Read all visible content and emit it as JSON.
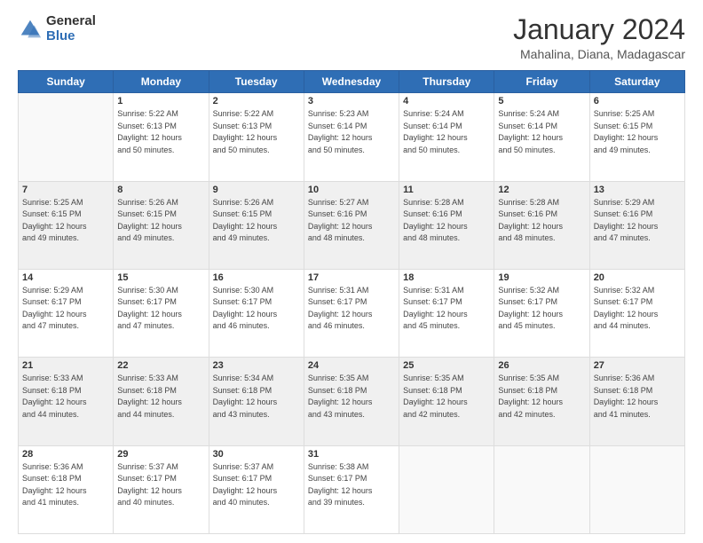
{
  "logo": {
    "general": "General",
    "blue": "Blue"
  },
  "title": "January 2024",
  "subtitle": "Mahalina, Diana, Madagascar",
  "days_of_week": [
    "Sunday",
    "Monday",
    "Tuesday",
    "Wednesday",
    "Thursday",
    "Friday",
    "Saturday"
  ],
  "weeks": [
    [
      {
        "day": "",
        "info": ""
      },
      {
        "day": "1",
        "info": "Sunrise: 5:22 AM\nSunset: 6:13 PM\nDaylight: 12 hours\nand 50 minutes."
      },
      {
        "day": "2",
        "info": "Sunrise: 5:22 AM\nSunset: 6:13 PM\nDaylight: 12 hours\nand 50 minutes."
      },
      {
        "day": "3",
        "info": "Sunrise: 5:23 AM\nSunset: 6:14 PM\nDaylight: 12 hours\nand 50 minutes."
      },
      {
        "day": "4",
        "info": "Sunrise: 5:24 AM\nSunset: 6:14 PM\nDaylight: 12 hours\nand 50 minutes."
      },
      {
        "day": "5",
        "info": "Sunrise: 5:24 AM\nSunset: 6:14 PM\nDaylight: 12 hours\nand 50 minutes."
      },
      {
        "day": "6",
        "info": "Sunrise: 5:25 AM\nSunset: 6:15 PM\nDaylight: 12 hours\nand 49 minutes."
      }
    ],
    [
      {
        "day": "7",
        "info": "Sunrise: 5:25 AM\nSunset: 6:15 PM\nDaylight: 12 hours\nand 49 minutes."
      },
      {
        "day": "8",
        "info": "Sunrise: 5:26 AM\nSunset: 6:15 PM\nDaylight: 12 hours\nand 49 minutes."
      },
      {
        "day": "9",
        "info": "Sunrise: 5:26 AM\nSunset: 6:15 PM\nDaylight: 12 hours\nand 49 minutes."
      },
      {
        "day": "10",
        "info": "Sunrise: 5:27 AM\nSunset: 6:16 PM\nDaylight: 12 hours\nand 48 minutes."
      },
      {
        "day": "11",
        "info": "Sunrise: 5:28 AM\nSunset: 6:16 PM\nDaylight: 12 hours\nand 48 minutes."
      },
      {
        "day": "12",
        "info": "Sunrise: 5:28 AM\nSunset: 6:16 PM\nDaylight: 12 hours\nand 48 minutes."
      },
      {
        "day": "13",
        "info": "Sunrise: 5:29 AM\nSunset: 6:16 PM\nDaylight: 12 hours\nand 47 minutes."
      }
    ],
    [
      {
        "day": "14",
        "info": "Sunrise: 5:29 AM\nSunset: 6:17 PM\nDaylight: 12 hours\nand 47 minutes."
      },
      {
        "day": "15",
        "info": "Sunrise: 5:30 AM\nSunset: 6:17 PM\nDaylight: 12 hours\nand 47 minutes."
      },
      {
        "day": "16",
        "info": "Sunrise: 5:30 AM\nSunset: 6:17 PM\nDaylight: 12 hours\nand 46 minutes."
      },
      {
        "day": "17",
        "info": "Sunrise: 5:31 AM\nSunset: 6:17 PM\nDaylight: 12 hours\nand 46 minutes."
      },
      {
        "day": "18",
        "info": "Sunrise: 5:31 AM\nSunset: 6:17 PM\nDaylight: 12 hours\nand 45 minutes."
      },
      {
        "day": "19",
        "info": "Sunrise: 5:32 AM\nSunset: 6:17 PM\nDaylight: 12 hours\nand 45 minutes."
      },
      {
        "day": "20",
        "info": "Sunrise: 5:32 AM\nSunset: 6:17 PM\nDaylight: 12 hours\nand 44 minutes."
      }
    ],
    [
      {
        "day": "21",
        "info": "Sunrise: 5:33 AM\nSunset: 6:18 PM\nDaylight: 12 hours\nand 44 minutes."
      },
      {
        "day": "22",
        "info": "Sunrise: 5:33 AM\nSunset: 6:18 PM\nDaylight: 12 hours\nand 44 minutes."
      },
      {
        "day": "23",
        "info": "Sunrise: 5:34 AM\nSunset: 6:18 PM\nDaylight: 12 hours\nand 43 minutes."
      },
      {
        "day": "24",
        "info": "Sunrise: 5:35 AM\nSunset: 6:18 PM\nDaylight: 12 hours\nand 43 minutes."
      },
      {
        "day": "25",
        "info": "Sunrise: 5:35 AM\nSunset: 6:18 PM\nDaylight: 12 hours\nand 42 minutes."
      },
      {
        "day": "26",
        "info": "Sunrise: 5:35 AM\nSunset: 6:18 PM\nDaylight: 12 hours\nand 42 minutes."
      },
      {
        "day": "27",
        "info": "Sunrise: 5:36 AM\nSunset: 6:18 PM\nDaylight: 12 hours\nand 41 minutes."
      }
    ],
    [
      {
        "day": "28",
        "info": "Sunrise: 5:36 AM\nSunset: 6:18 PM\nDaylight: 12 hours\nand 41 minutes."
      },
      {
        "day": "29",
        "info": "Sunrise: 5:37 AM\nSunset: 6:17 PM\nDaylight: 12 hours\nand 40 minutes."
      },
      {
        "day": "30",
        "info": "Sunrise: 5:37 AM\nSunset: 6:17 PM\nDaylight: 12 hours\nand 40 minutes."
      },
      {
        "day": "31",
        "info": "Sunrise: 5:38 AM\nSunset: 6:17 PM\nDaylight: 12 hours\nand 39 minutes."
      },
      {
        "day": "",
        "info": ""
      },
      {
        "day": "",
        "info": ""
      },
      {
        "day": "",
        "info": ""
      }
    ]
  ]
}
